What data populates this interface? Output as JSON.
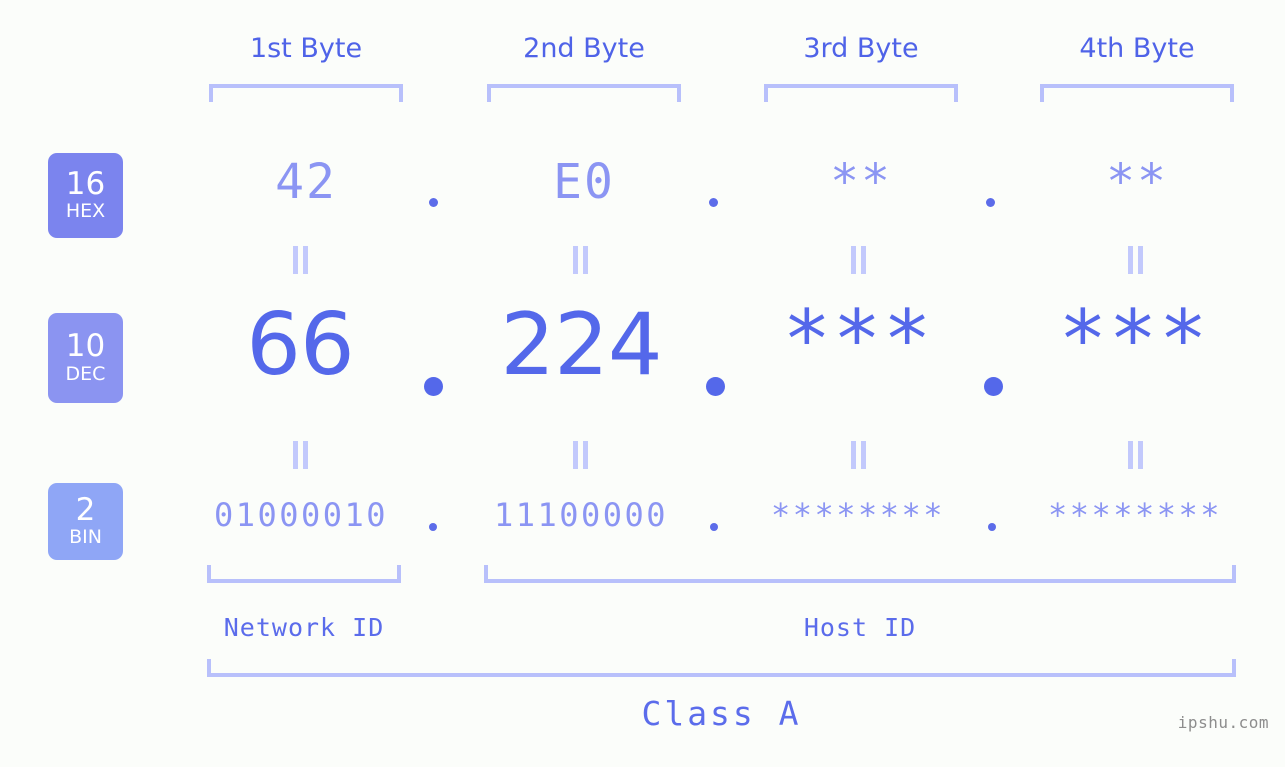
{
  "watermark": "ipshu.com",
  "background_color": "#fbfdfa",
  "accent_colors": {
    "label_blue": "#4f63e8",
    "bracket_blue": "#b8c0fb",
    "value_light": "#8b95f3",
    "value_strong": "#5468ea",
    "badge_hex": "#7b84ee",
    "badge_dec": "#8b94f1",
    "badge_bin": "#8fa6f6",
    "watermark_gray": "#8d8d8d"
  },
  "columns": [
    {
      "label": "1st Byte"
    },
    {
      "label": "2nd Byte"
    },
    {
      "label": "3rd Byte"
    },
    {
      "label": "4th Byte"
    }
  ],
  "bases": [
    {
      "number": "16",
      "name": "HEX"
    },
    {
      "number": "10",
      "name": "DEC"
    },
    {
      "number": "2",
      "name": "BIN"
    }
  ],
  "rows": {
    "hex": {
      "values": [
        "42",
        "E0",
        "**",
        "**"
      ],
      "separator": "."
    },
    "dec": {
      "values": [
        "66",
        "224",
        "***",
        "***"
      ],
      "separator": "."
    },
    "bin": {
      "values": [
        "01000010",
        "11100000",
        "********",
        "********"
      ],
      "separator": "."
    }
  },
  "connector_symbol": "||",
  "sections": {
    "network_id": "Network ID",
    "host_id": "Host ID",
    "class": "Class A"
  }
}
